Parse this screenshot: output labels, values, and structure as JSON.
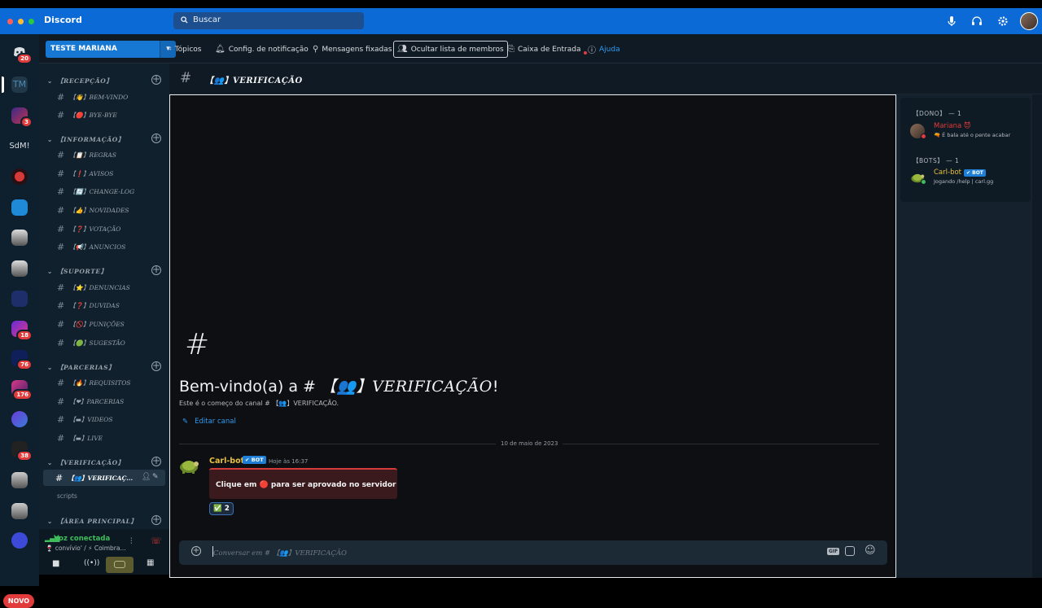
{
  "titlebar": {
    "app_name": "Discord",
    "search_placeholder": "Buscar"
  },
  "servers": [
    {
      "name": "direct-messages",
      "badge": "20"
    },
    {
      "name": "TM",
      "badge": ""
    },
    {
      "name": "server-2",
      "badge": "3"
    },
    {
      "name": "SdM!",
      "badge": ""
    },
    {
      "name": "server-4",
      "badge": ""
    },
    {
      "name": "server-5",
      "badge": ""
    },
    {
      "name": "server-6",
      "badge": ""
    },
    {
      "name": "server-7",
      "badge": ""
    },
    {
      "name": "server-8",
      "badge": ""
    },
    {
      "name": "server-9",
      "badge": "18"
    },
    {
      "name": "server-10",
      "badge": "76"
    },
    {
      "name": "server-11",
      "badge": "176"
    },
    {
      "name": "server-12",
      "badge": ""
    },
    {
      "name": "server-13",
      "badge": "38"
    },
    {
      "name": "server-14",
      "badge": ""
    },
    {
      "name": "server-15",
      "badge": ""
    },
    {
      "name": "server-16",
      "badge": ""
    }
  ],
  "rail": {
    "tm_label": "TM",
    "sdm_label": "SdM!",
    "novo": "NOVO"
  },
  "toolbar": {
    "server_name": "TESTE MARIANA",
    "topics": "Tópicos",
    "notif": "Config. de notificação",
    "pinned": "Mensagens fixadas",
    "hide_members": "Ocultar lista de membros",
    "inbox": "Caixa de Entrada",
    "help": "Ajuda"
  },
  "sidebar": {
    "categories": [
      {
        "label": "【RECEPÇÃO】"
      },
      {
        "label": "【INFORMAÇÃO】"
      },
      {
        "label": "【SUPORTE】"
      },
      {
        "label": "【PARCERIAS】"
      },
      {
        "label": "【VERIFICAÇÃO】"
      },
      {
        "label": "【ÁREA PRINCIPAL】"
      }
    ],
    "channels": [
      {
        "label": "【👋】BEM-VINDO"
      },
      {
        "label": "【🔴】BYE-BYE"
      },
      {
        "label": "【📋】REGRAS"
      },
      {
        "label": "【❗】AVISOS"
      },
      {
        "label": "【🔄】CHANGE-LOG"
      },
      {
        "label": "【👍】NOVIDADES"
      },
      {
        "label": "【❓】VOTAÇÃO"
      },
      {
        "label": "【📢】ANUNCIOS"
      },
      {
        "label": "【⭐】DENUNCIAS"
      },
      {
        "label": "【❓】DUVIDAS"
      },
      {
        "label": "【🚫】PUNIÇÕES"
      },
      {
        "label": "【🟢】SUGESTÃO"
      },
      {
        "label": "【🔥】REQUISITOS"
      },
      {
        "label": "【❤】PARCERIAS"
      },
      {
        "label": "【▬】VIDEOS"
      },
      {
        "label": "【▬】LIVE"
      },
      {
        "label": "【👥】VERIFICAÇ..."
      }
    ],
    "scripts": "scripts"
  },
  "voice": {
    "status": "Voz conectada",
    "location": "🍷 convívio' / ⚡ Coimbra..."
  },
  "channel": {
    "name": "【👥】VERIFICAÇÃO",
    "hash": "#"
  },
  "welcome": {
    "hash": "#",
    "prefix": "Bem-vindo(a) a # ",
    "channel": "【👥】VERIFICAÇÃO",
    "bang": "!",
    "sub": "Este é o começo do canal # 【👥】VERIFICAÇÃO.",
    "edit": "Editar canal"
  },
  "date_divider": "10 de maio de 2023",
  "message": {
    "author": "Carl-bot",
    "bot_tag": "✔ BOT",
    "time": "Hoje às 16:37",
    "embed": "Clique em 🔴 para ser aprovado no servidor",
    "reaction_emoji": "✅",
    "reaction_count": "2"
  },
  "composer": {
    "placeholder": "Conversar em # 【👥】VERIFICAÇÃO"
  },
  "members": {
    "roles": [
      {
        "label": "【DONO】 — 1"
      },
      {
        "label": "【BOTS】 — 1"
      }
    ],
    "list": [
      {
        "name": "Mariana 😈",
        "status": "🔫 É bala até o pente acabar"
      },
      {
        "name": "Carl-bot",
        "tag": "✔ BOT",
        "status": "Jogando /help | carl.gg"
      }
    ]
  },
  "colors": {
    "accent": "#1778d4",
    "online": "#3fbd5c",
    "danger": "#e23b3b",
    "bot_name": "#e7c140",
    "owner_name": "#e23b3b"
  }
}
